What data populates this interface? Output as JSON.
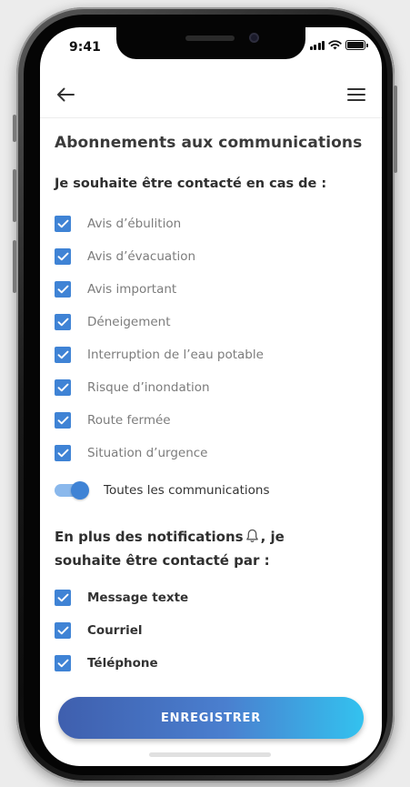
{
  "status_bar": {
    "time": "9:41",
    "icons": [
      "signal-icon",
      "wifi-icon",
      "battery-icon"
    ]
  },
  "header": {
    "back_icon": "arrow-left-icon",
    "menu_icon": "hamburger-menu-icon"
  },
  "page": {
    "title": "Abonnements aux communications",
    "subtitle": "Je souhaite être contacté en cas de :"
  },
  "categories": [
    {
      "label": "Avis d’ébulition",
      "checked": true
    },
    {
      "label": "Avis d’évacuation",
      "checked": true
    },
    {
      "label": "Avis important",
      "checked": true
    },
    {
      "label": "Déneigement",
      "checked": true
    },
    {
      "label": "Interruption de l’eau potable",
      "checked": true
    },
    {
      "label": "Risque d’inondation",
      "checked": true
    },
    {
      "label": "Route fermée",
      "checked": true
    },
    {
      "label": "Situation d’urgence",
      "checked": true
    }
  ],
  "all_toggle": {
    "label": "Toutes les communications",
    "on": true
  },
  "notifications": {
    "title_before": "En plus des notifications",
    "title_after": ", je souhaite être contacté par :",
    "icon": "bell-icon"
  },
  "contact_methods": [
    {
      "label": "Message texte",
      "checked": true
    },
    {
      "label": "Courriel",
      "checked": true
    },
    {
      "label": "Téléphone",
      "checked": true
    }
  ],
  "save_label": "ENREGISTRER",
  "colors": {
    "accent": "#3f83d5",
    "button_start": "#3f5fae",
    "button_end": "#33c2ef"
  }
}
